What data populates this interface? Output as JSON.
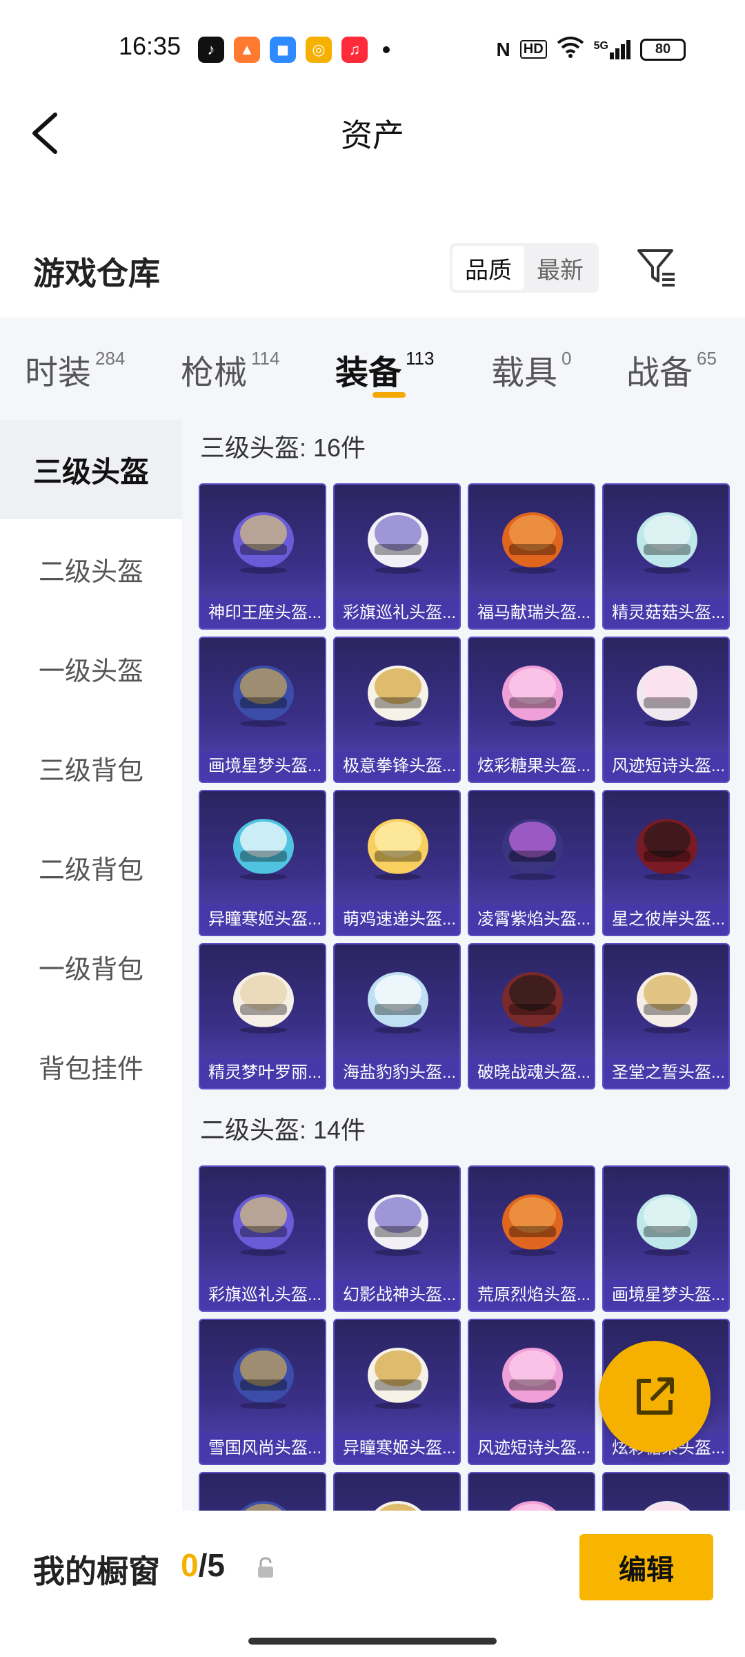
{
  "status_bar": {
    "time": "16:35",
    "battery": "80",
    "network": "5G",
    "apps": [
      {
        "name": "tiktok-icon",
        "glyph": "♪",
        "color": "#111111"
      },
      {
        "name": "game-icon",
        "glyph": "▲",
        "color": "#ff7a2f"
      },
      {
        "name": "cloud-icon",
        "glyph": "◼",
        "color": "#2e8bff"
      },
      {
        "name": "coin-icon",
        "glyph": "◎",
        "color": "#f5b000"
      },
      {
        "name": "music-icon",
        "glyph": "♫",
        "color": "#ff2a3a"
      }
    ]
  },
  "header": {
    "title": "资产"
  },
  "warehouse": {
    "title": "游戏仓库",
    "sort_options": [
      "品质",
      "最新"
    ]
  },
  "tabs": [
    {
      "label": "时装",
      "count": "284"
    },
    {
      "label": "枪械",
      "count": "114"
    },
    {
      "label": "装备",
      "count": "113"
    },
    {
      "label": "载具",
      "count": "0"
    },
    {
      "label": "战备",
      "count": "65"
    }
  ],
  "sidebar": [
    "三级头盔",
    "二级头盔",
    "一级头盔",
    "三级背包",
    "二级背包",
    "一级背包",
    "背包挂件"
  ],
  "sections": [
    {
      "title": "三级头盔: 16件",
      "items": [
        "神印王座头盔...",
        "彩旗巡礼头盔...",
        "福马献瑞头盔...",
        "精灵菇菇头盔...",
        "画境星梦头盔...",
        "极意拳锋头盔...",
        "炫彩糖果头盔...",
        "风迹短诗头盔...",
        "异瞳寒姬头盔...",
        "萌鸡速递头盔...",
        "凌霄紫焰头盔...",
        "星之彼岸头盔...",
        "精灵梦叶罗丽...",
        "海盐豹豹头盔...",
        "破晓战魂头盔...",
        "圣堂之誓头盔..."
      ]
    },
    {
      "title": "二级头盔: 14件",
      "items": [
        "彩旗巡礼头盔...",
        "幻影战神头盔...",
        "荒原烈焰头盔...",
        "画境星梦头盔...",
        "雪国风尚头盔...",
        "异瞳寒姬头盔...",
        "风迹短诗头盔...",
        "炫彩糖果头盔..."
      ]
    }
  ],
  "bottom_bar": {
    "title": "我的橱窗",
    "current": "0",
    "total": "/5",
    "edit_label": "编辑"
  },
  "colors": {
    "accent": "#f5b000",
    "card_top": "#2a2560",
    "card_bottom": "#5646b6"
  }
}
